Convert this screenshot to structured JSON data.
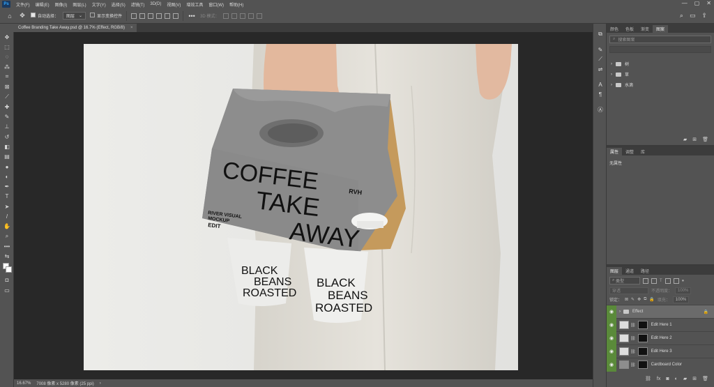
{
  "app": {
    "logo": "Ps"
  },
  "menu": [
    "文件(F)",
    "编辑(E)",
    "图像(I)",
    "图层(L)",
    "文字(Y)",
    "选择(S)",
    "滤镜(T)",
    "3D(D)",
    "视图(V)",
    "增效工具",
    "窗口(W)",
    "帮助(H)"
  ],
  "window_controls": [
    "—",
    "▢",
    "✕"
  ],
  "options": {
    "auto_select_label": "自动选择：",
    "auto_select_value": "图层",
    "show_transform_label": "显示变换控件",
    "mode_3d_label": "3D 模式："
  },
  "document_tab": {
    "title": "Coffee Branding Take Away.psd @ 16.7% (Effect, RGB/8)",
    "close": "×"
  },
  "mockup": {
    "carrier_lines": [
      "COFFEE",
      "TAKE",
      "AWAY"
    ],
    "carrier_brand": "RVH",
    "carrier_small": [
      "RIVER VISUAL",
      "MOCKUP",
      "EDIT"
    ],
    "cup_text": [
      "BLACK",
      "BEANS",
      "ROASTED"
    ],
    "colors": {
      "carrier": "#8d8d8d",
      "kraft": "#c59a5c",
      "pants": "#e1ded6",
      "backdrop": "#e9e9e7"
    }
  },
  "status": {
    "zoom": "16.67%",
    "info": "7008 像素 x 5280 像素 (25 ppi)"
  },
  "top_panel": {
    "tabs": [
      "颜色",
      "色板",
      "渐变",
      "图案"
    ],
    "active_tab": 3,
    "search_placeholder": "搜索图案",
    "groups": [
      "树",
      "草",
      "水滴"
    ]
  },
  "properties_panel": {
    "tabs": [
      "属性",
      "调整",
      "库"
    ],
    "active_tab": 0,
    "empty_text": "无属性"
  },
  "layers_panel": {
    "tabs": [
      "图层",
      "通道",
      "路径"
    ],
    "active_tab": 0,
    "filter_kind": "类型",
    "blend_mode": "穿透",
    "opacity_label": "不透明度：",
    "opacity_value": "100%",
    "lock_label": "锁定：",
    "fill_label": "填充：",
    "fill_value": "100%",
    "layers": [
      {
        "name": "Effect",
        "type": "group",
        "selected": true
      },
      {
        "name": "Edit Here 1",
        "type": "smart"
      },
      {
        "name": "Edit Here 2",
        "type": "smart"
      },
      {
        "name": "Edit Here 3",
        "type": "smart"
      },
      {
        "name": "Cardboard Color",
        "type": "fill"
      }
    ]
  }
}
